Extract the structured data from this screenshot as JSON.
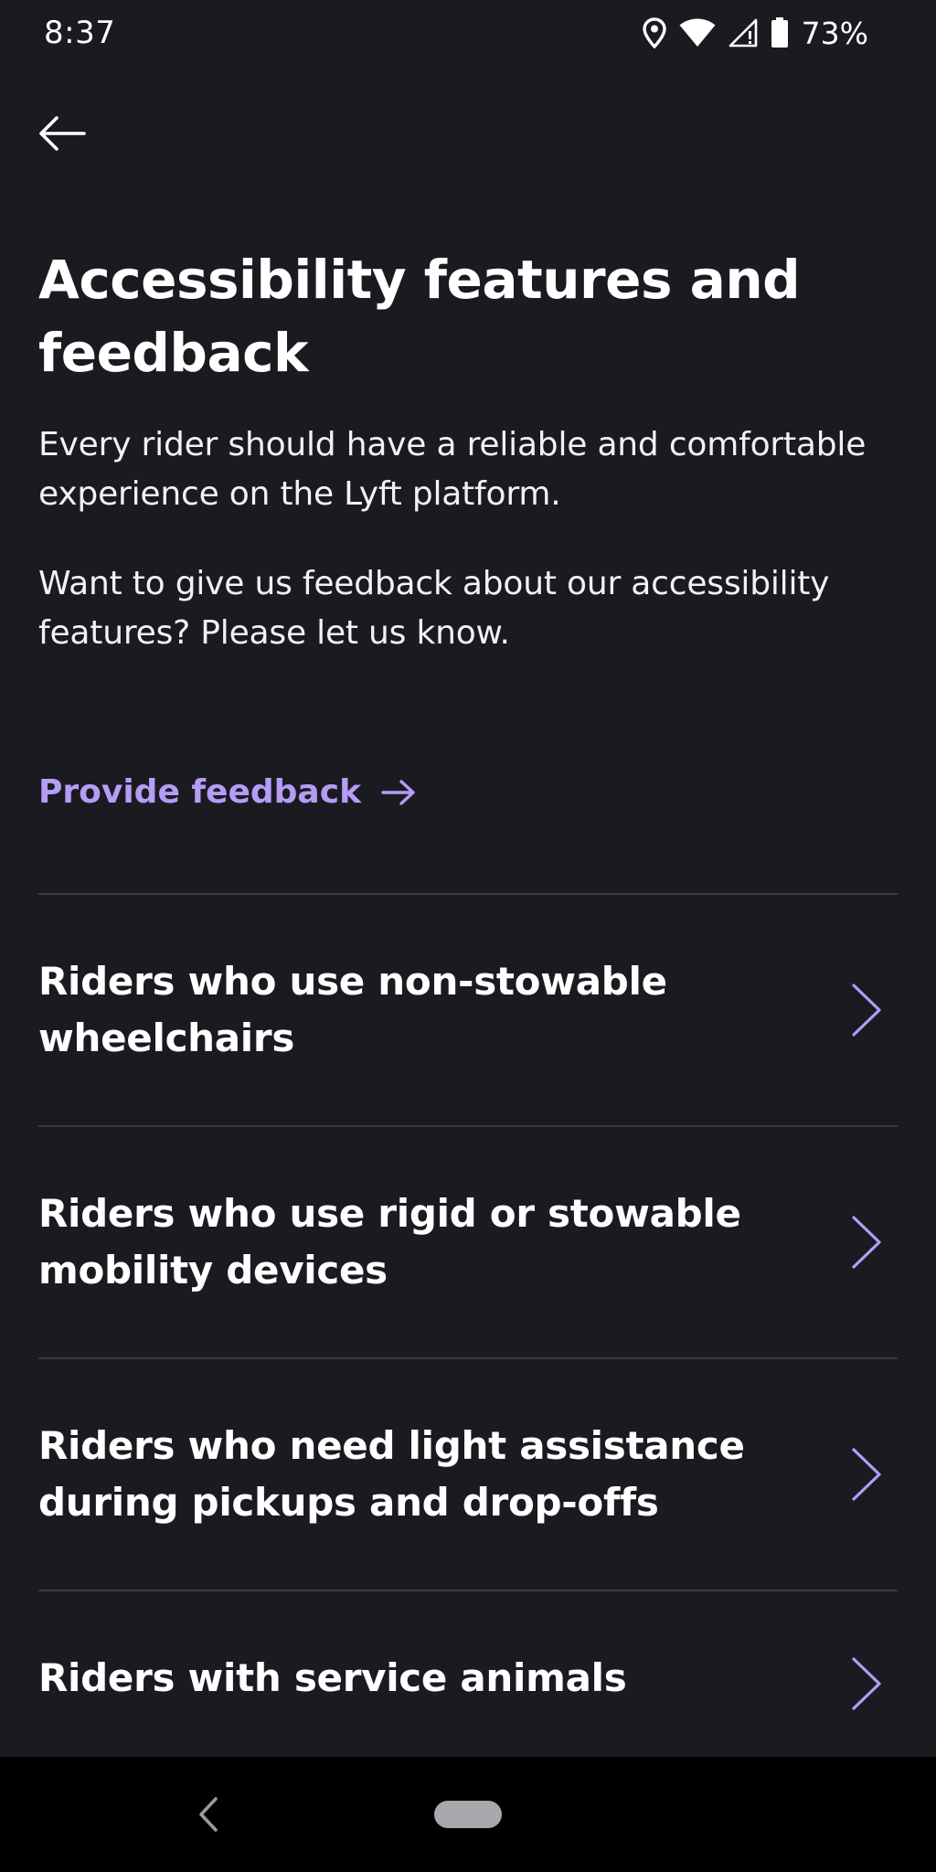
{
  "status_bar": {
    "time": "8:37",
    "battery_percent": "73%",
    "icons": [
      "location-icon",
      "wifi-icon",
      "cell-signal-icon",
      "battery-icon"
    ]
  },
  "header": {
    "back_icon": "arrow-left-icon"
  },
  "main": {
    "title": "Accessibility features and feedback",
    "paragraph_1": "Every rider should have a reliable and comfortable experience on the Lyft platform.",
    "paragraph_2": "Want to give us feedback about our accessibility features? Please let us know.",
    "feedback_link": {
      "label": "Provide feedback",
      "icon": "arrow-right-icon"
    }
  },
  "list": {
    "items": [
      {
        "label": "Riders who use non-stowable wheelchairs",
        "icon": "chevron-right-icon"
      },
      {
        "label": "Riders who use rigid or stowable mobility devices",
        "icon": "chevron-right-icon"
      },
      {
        "label": "Riders who need light assistance during pickups and drop-offs",
        "icon": "chevron-right-icon"
      },
      {
        "label": "Riders with service animals",
        "icon": "chevron-right-icon"
      }
    ]
  },
  "nav_bar": {
    "icons": [
      "nav-back-icon",
      "home-pill-icon"
    ]
  },
  "colors": {
    "background": "#1a1a21",
    "accent": "#b59cf5",
    "divider": "#3a3a43",
    "text": "#ffffff"
  }
}
